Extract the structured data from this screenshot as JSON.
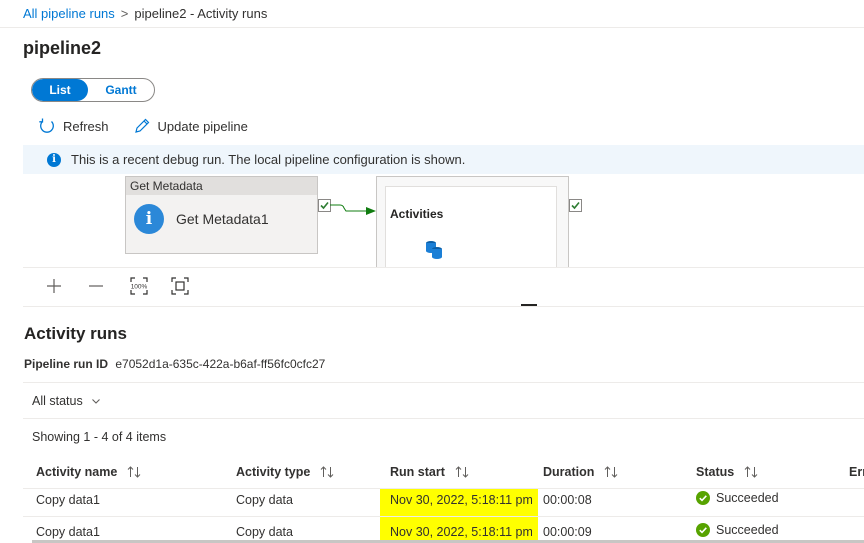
{
  "breadcrumb": {
    "root": "All pipeline runs",
    "separator": ">",
    "current": "pipeline2 - Activity runs"
  },
  "page": {
    "title": "pipeline2"
  },
  "view_toggle": {
    "list": "List",
    "gantt": "Gantt",
    "selected": "List"
  },
  "toolbar": {
    "refresh": "Refresh",
    "update_pipeline": "Update pipeline"
  },
  "info_bar": {
    "message": "This is a recent debug run. The local pipeline configuration is shown."
  },
  "canvas": {
    "activity": {
      "type_label": "Get Metadata",
      "name": "Get Metadata1"
    },
    "foreach": {
      "label": "Activities"
    }
  },
  "zoom": {
    "zoom_in": "+",
    "zoom_out": "—",
    "reset_label": "100%"
  },
  "activity_runs": {
    "title": "Activity runs",
    "run_id_label": "Pipeline run ID",
    "run_id": "e7052d1a-635c-422a-b6af-ff56fc0cfc27",
    "status_filter": "All status",
    "showing": "Showing 1 - 4 of 4 items",
    "columns": [
      "Activity name",
      "Activity type",
      "Run start",
      "Duration",
      "Status",
      "Err"
    ],
    "rows": [
      {
        "name": "Copy data1",
        "type": "Copy data",
        "run_start": "Nov 30, 2022, 5:18:11 pm",
        "duration": "00:00:08",
        "status": "Succeeded"
      },
      {
        "name": "Copy data1",
        "type": "Copy data",
        "run_start": "Nov 30, 2022, 5:18:11 pm",
        "duration": "00:00:09",
        "status": "Succeeded"
      }
    ]
  },
  "colors": {
    "accent": "#0078d4",
    "success": "#57a300",
    "highlight": "#ffff00",
    "info_bg": "#eff6fc"
  }
}
